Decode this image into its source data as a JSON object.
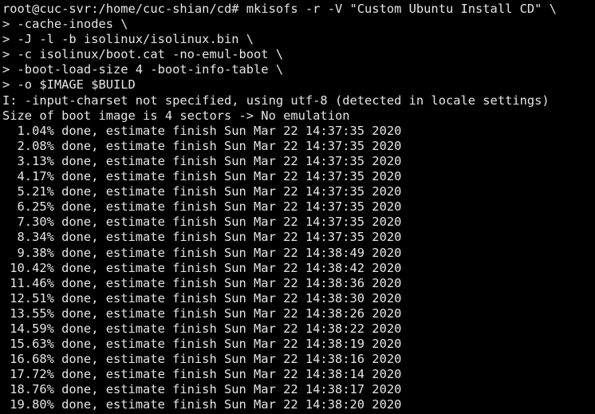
{
  "terminal": {
    "lines": [
      "root@cuc-svr:/home/cuc-shian/cd# mkisofs -r -V \"Custom Ubuntu Install CD\" \\",
      "> -cache-inodes \\",
      "> -J -l -b isolinux/isolinux.bin \\",
      "> -c isolinux/boot.cat -no-emul-boot \\",
      "> -boot-load-size 4 -boot-info-table \\",
      "> -o $IMAGE $BUILD",
      "I: -input-charset not specified, using utf-8 (detected in locale settings)",
      "Size of boot image is 4 sectors -> No emulation",
      "  1.04% done, estimate finish Sun Mar 22 14:37:35 2020",
      "  2.08% done, estimate finish Sun Mar 22 14:37:35 2020",
      "  3.13% done, estimate finish Sun Mar 22 14:37:35 2020",
      "  4.17% done, estimate finish Sun Mar 22 14:37:35 2020",
      "  5.21% done, estimate finish Sun Mar 22 14:37:35 2020",
      "  6.25% done, estimate finish Sun Mar 22 14:37:35 2020",
      "  7.30% done, estimate finish Sun Mar 22 14:37:35 2020",
      "  8.34% done, estimate finish Sun Mar 22 14:37:35 2020",
      "  9.38% done, estimate finish Sun Mar 22 14:38:49 2020",
      " 10.42% done, estimate finish Sun Mar 22 14:38:42 2020",
      " 11.46% done, estimate finish Sun Mar 22 14:38:36 2020",
      " 12.51% done, estimate finish Sun Mar 22 14:38:30 2020",
      " 13.55% done, estimate finish Sun Mar 22 14:38:26 2020",
      " 14.59% done, estimate finish Sun Mar 22 14:38:22 2020",
      " 15.63% done, estimate finish Sun Mar 22 14:38:19 2020",
      " 16.68% done, estimate finish Sun Mar 22 14:38:16 2020",
      " 17.72% done, estimate finish Sun Mar 22 14:38:14 2020",
      " 18.76% done, estimate finish Sun Mar 22 14:38:17 2020",
      " 19.80% done, estimate finish Sun Mar 22 14:38:20 2020"
    ]
  },
  "colors": {
    "background": "#000000",
    "foreground": "#e6e6e6"
  }
}
